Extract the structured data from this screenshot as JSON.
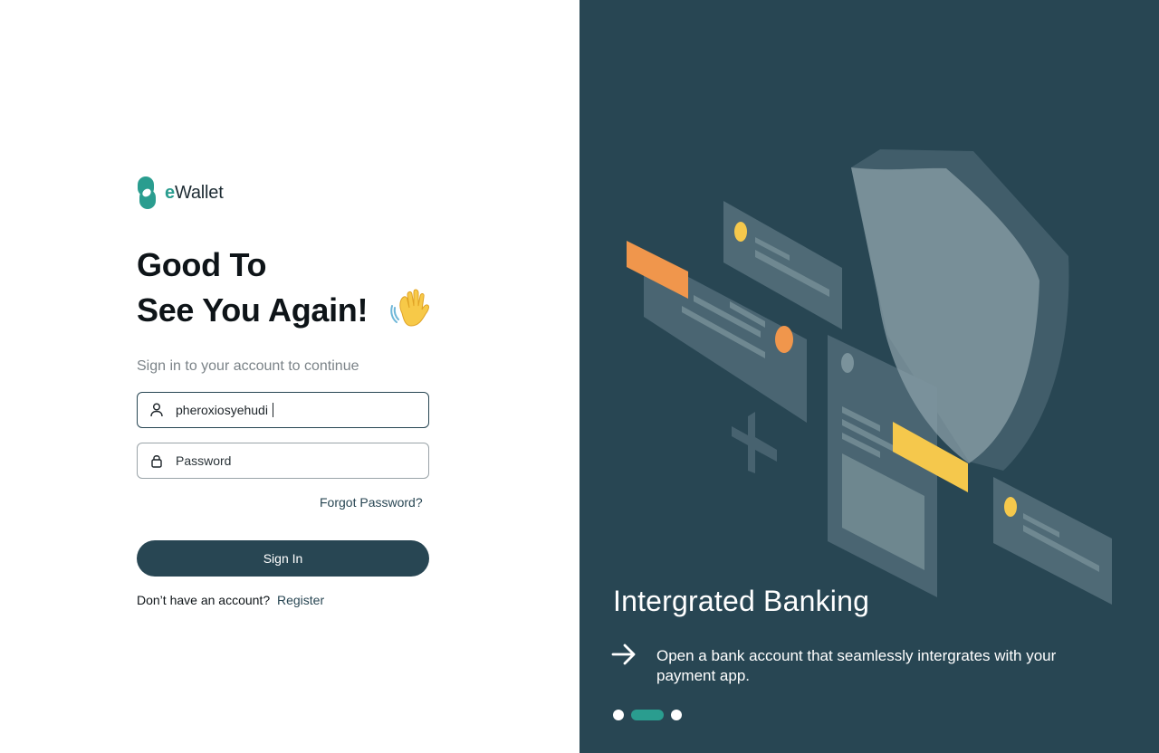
{
  "brand": {
    "prefix": "e",
    "name": "Wallet",
    "accent_color": "#2a9d8f"
  },
  "headline": {
    "line1": "Good To",
    "line2": "See You Again!",
    "emoji_icon": "waving-hand-icon"
  },
  "subtitle": "Sign in to your account to continue",
  "form": {
    "username": {
      "value": "pheroxiosyehudi",
      "icon": "user-icon"
    },
    "password": {
      "placeholder": "Password",
      "icon": "lock-icon"
    },
    "forgot_label": "Forgot Password?",
    "signin_label": "Sign In",
    "register_prompt": "Don’t have an account?",
    "register_label": "Register"
  },
  "slide": {
    "title": "Intergrated Banking",
    "description": "Open a bank account that seamlessly intergrates with your payment app.",
    "arrow_icon": "arrow-right-icon",
    "background_color": "#284653",
    "total_slides": 3,
    "active_slide": 2
  }
}
